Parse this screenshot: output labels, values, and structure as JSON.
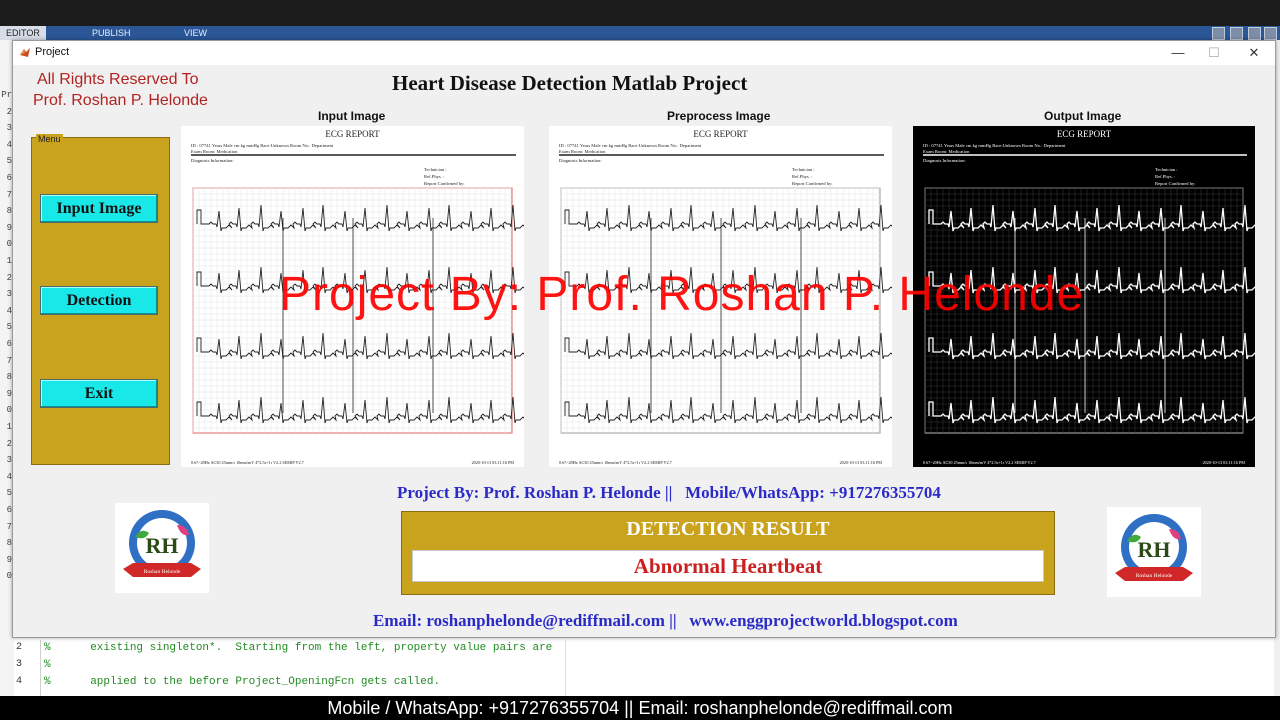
{
  "editor": {
    "tabs": [
      "EDITOR",
      "PUBLISH",
      "VIEW"
    ],
    "line_numbers": [
      "Pr",
      "2",
      "3",
      "4",
      "5",
      "6",
      "7",
      "8",
      "9",
      "0",
      "1",
      "2",
      "3",
      "4",
      "5",
      "6",
      "7",
      "8",
      "9",
      "0",
      "1",
      "2",
      "3",
      "4",
      "5",
      "6",
      "7",
      "8",
      "9",
      "0"
    ],
    "code_lines": [
      {
        "no": "2",
        "text": "%      existing singleton*.  Starting from the left, property value pairs are"
      },
      {
        "no": "3",
        "text": "%"
      },
      {
        "no": "4",
        "text": "%      applied to the before Project_OpeningFcn gets called."
      }
    ]
  },
  "window": {
    "title": "Project",
    "minimize": "—",
    "maximize": "☐",
    "close": "✕"
  },
  "rights": {
    "line1": "All Rights Reserved To",
    "line2": "Prof. Roshan P. Helonde"
  },
  "heading": "Heart Disease Detection Matlab Project",
  "axes": {
    "input": "Input Image",
    "preprocess": "Preprocess Image",
    "output": "Output Image"
  },
  "ecg_report": {
    "title": "ECG REPORT",
    "header": "ID : 07741    Years   Male      cm      kg       mmHg  Race:Unknown   Room No.:   Department",
    "sub": "Exam Room:   Medication",
    "diag": "Diagnosis Information:",
    "tech1": "Technician :",
    "tech2": "Ref.Phys. :",
    "tech3": "Report Confirmed by:",
    "footer_left": "0.67~20Hz  AC50  25mm/s  10mm/mV  4*2.5s+1r  V2.2   SEMIP V2.7",
    "footer_right": "2020-10-13   03:11:16 PM"
  },
  "menu": {
    "label": "Menu",
    "buttons": [
      "Input Image",
      "Detection",
      "Exit"
    ]
  },
  "watermark": "Project By:  Prof. Roshan P. Helonde",
  "project_line": "Project By: Prof. Roshan P. Helonde ||   Mobile/WhatsApp: +917276355704",
  "result": {
    "title": "DETECTION RESULT",
    "value": "Abnormal Heartbeat"
  },
  "email_line": "Email: roshanphelonde@rediffmail.com ||   www.enggprojectworld.blogspot.com",
  "logo_text": "Roshan Helonde",
  "logo_letters": "RH",
  "bottom_banner": "Mobile / WhatsApp: +917276355704 || Email: roshanphelonde@rediffmail.com",
  "colors": {
    "panel": "#c9a21e",
    "button": "#18e8e8",
    "watermark": "#ff0000",
    "result_text": "#cc1f1f",
    "link_blue": "#2a2ac8"
  }
}
